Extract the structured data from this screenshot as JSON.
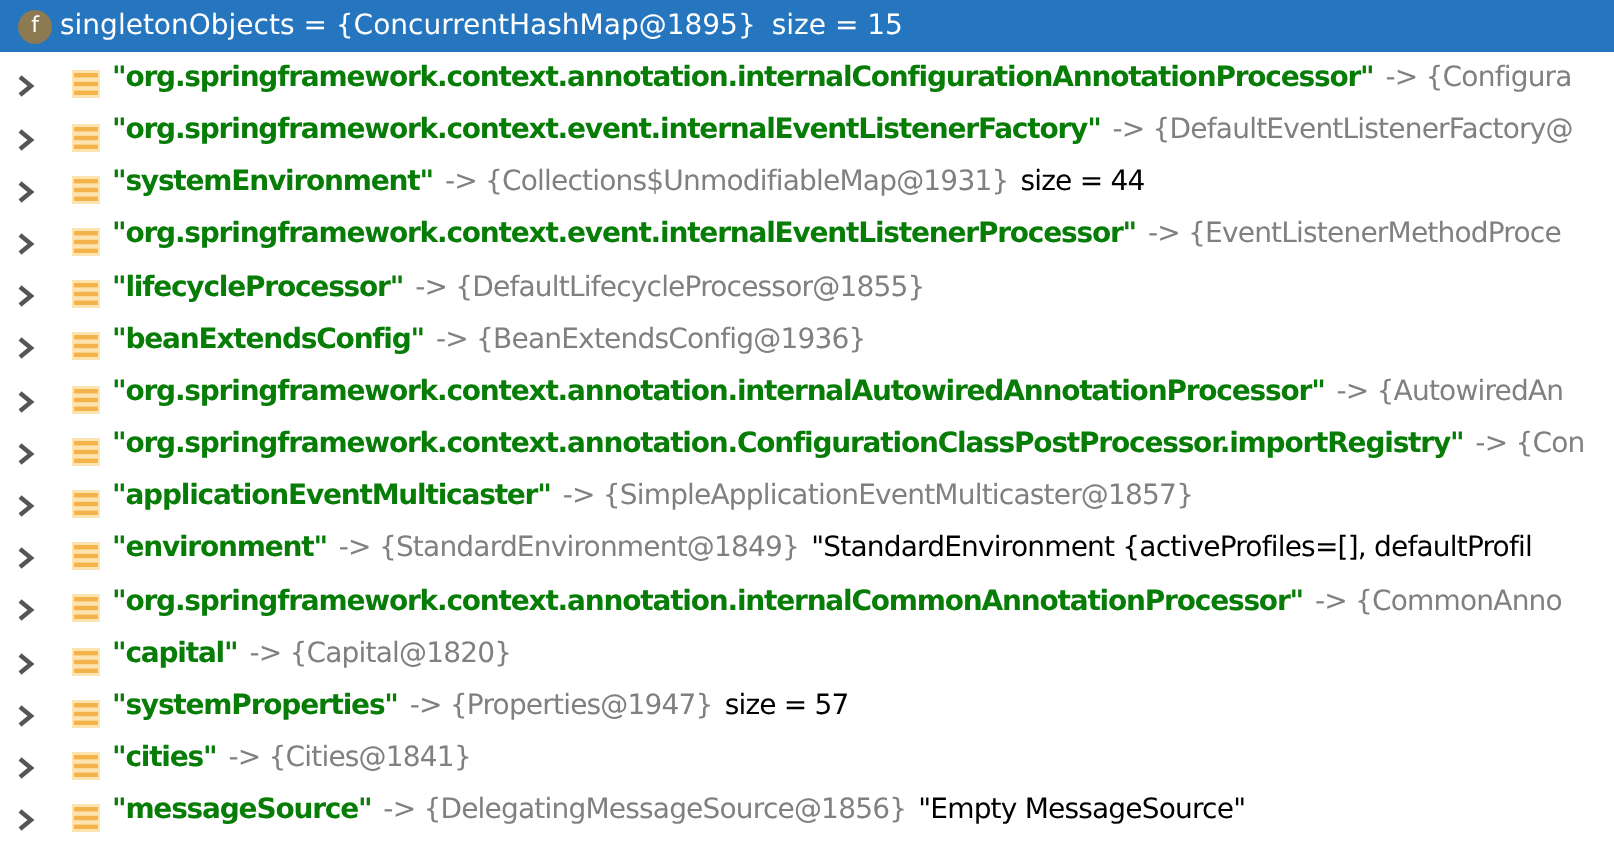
{
  "header": {
    "badge": "f",
    "text": "singletonObjects = {ConcurrentHashMap@1895}",
    "size": "size = 15",
    "selected": true
  },
  "entries": [
    {
      "key": "\"org.springframework.context.annotation.internalConfigurationAnnotationProcessor\"",
      "ref": "-> {Configura"
    },
    {
      "key": "\"org.springframework.context.event.internalEventListenerFactory\"",
      "ref": "-> {DefaultEventListenerFactory@"
    },
    {
      "key": "\"systemEnvironment\"",
      "ref": "-> {Collections$UnmodifiableMap@1931}",
      "extra": "size = 44"
    },
    {
      "key": "\"org.springframework.context.event.internalEventListenerProcessor\"",
      "ref": "-> {EventListenerMethodProce"
    },
    {
      "key": "\"lifecycleProcessor\"",
      "ref": "-> {DefaultLifecycleProcessor@1855}"
    },
    {
      "key": "\"beanExtendsConfig\"",
      "ref": "-> {BeanExtendsConfig@1936}"
    },
    {
      "key": "\"org.springframework.context.annotation.internalAutowiredAnnotationProcessor\"",
      "ref": "-> {AutowiredAn"
    },
    {
      "key": "\"org.springframework.context.annotation.ConfigurationClassPostProcessor.importRegistry\"",
      "ref": "-> {Con"
    },
    {
      "key": "\"applicationEventMulticaster\"",
      "ref": "-> {SimpleApplicationEventMulticaster@1857}"
    },
    {
      "key": "\"environment\"",
      "ref": "-> {StandardEnvironment@1849}",
      "extra": "\"StandardEnvironment {activeProfiles=[], defaultProfil"
    },
    {
      "key": "\"org.springframework.context.annotation.internalCommonAnnotationProcessor\"",
      "ref": "-> {CommonAnno"
    },
    {
      "key": "\"capital\"",
      "ref": "-> {Capital@1820}"
    },
    {
      "key": "\"systemProperties\"",
      "ref": "-> {Properties@1947}",
      "extra": "size = 57"
    },
    {
      "key": "\"cities\"",
      "ref": "-> {Cities@1841}"
    },
    {
      "key": "\"messageSource\"",
      "ref": "-> {DelegatingMessageSource@1856}",
      "extra": "\"Empty MessageSource\""
    }
  ]
}
